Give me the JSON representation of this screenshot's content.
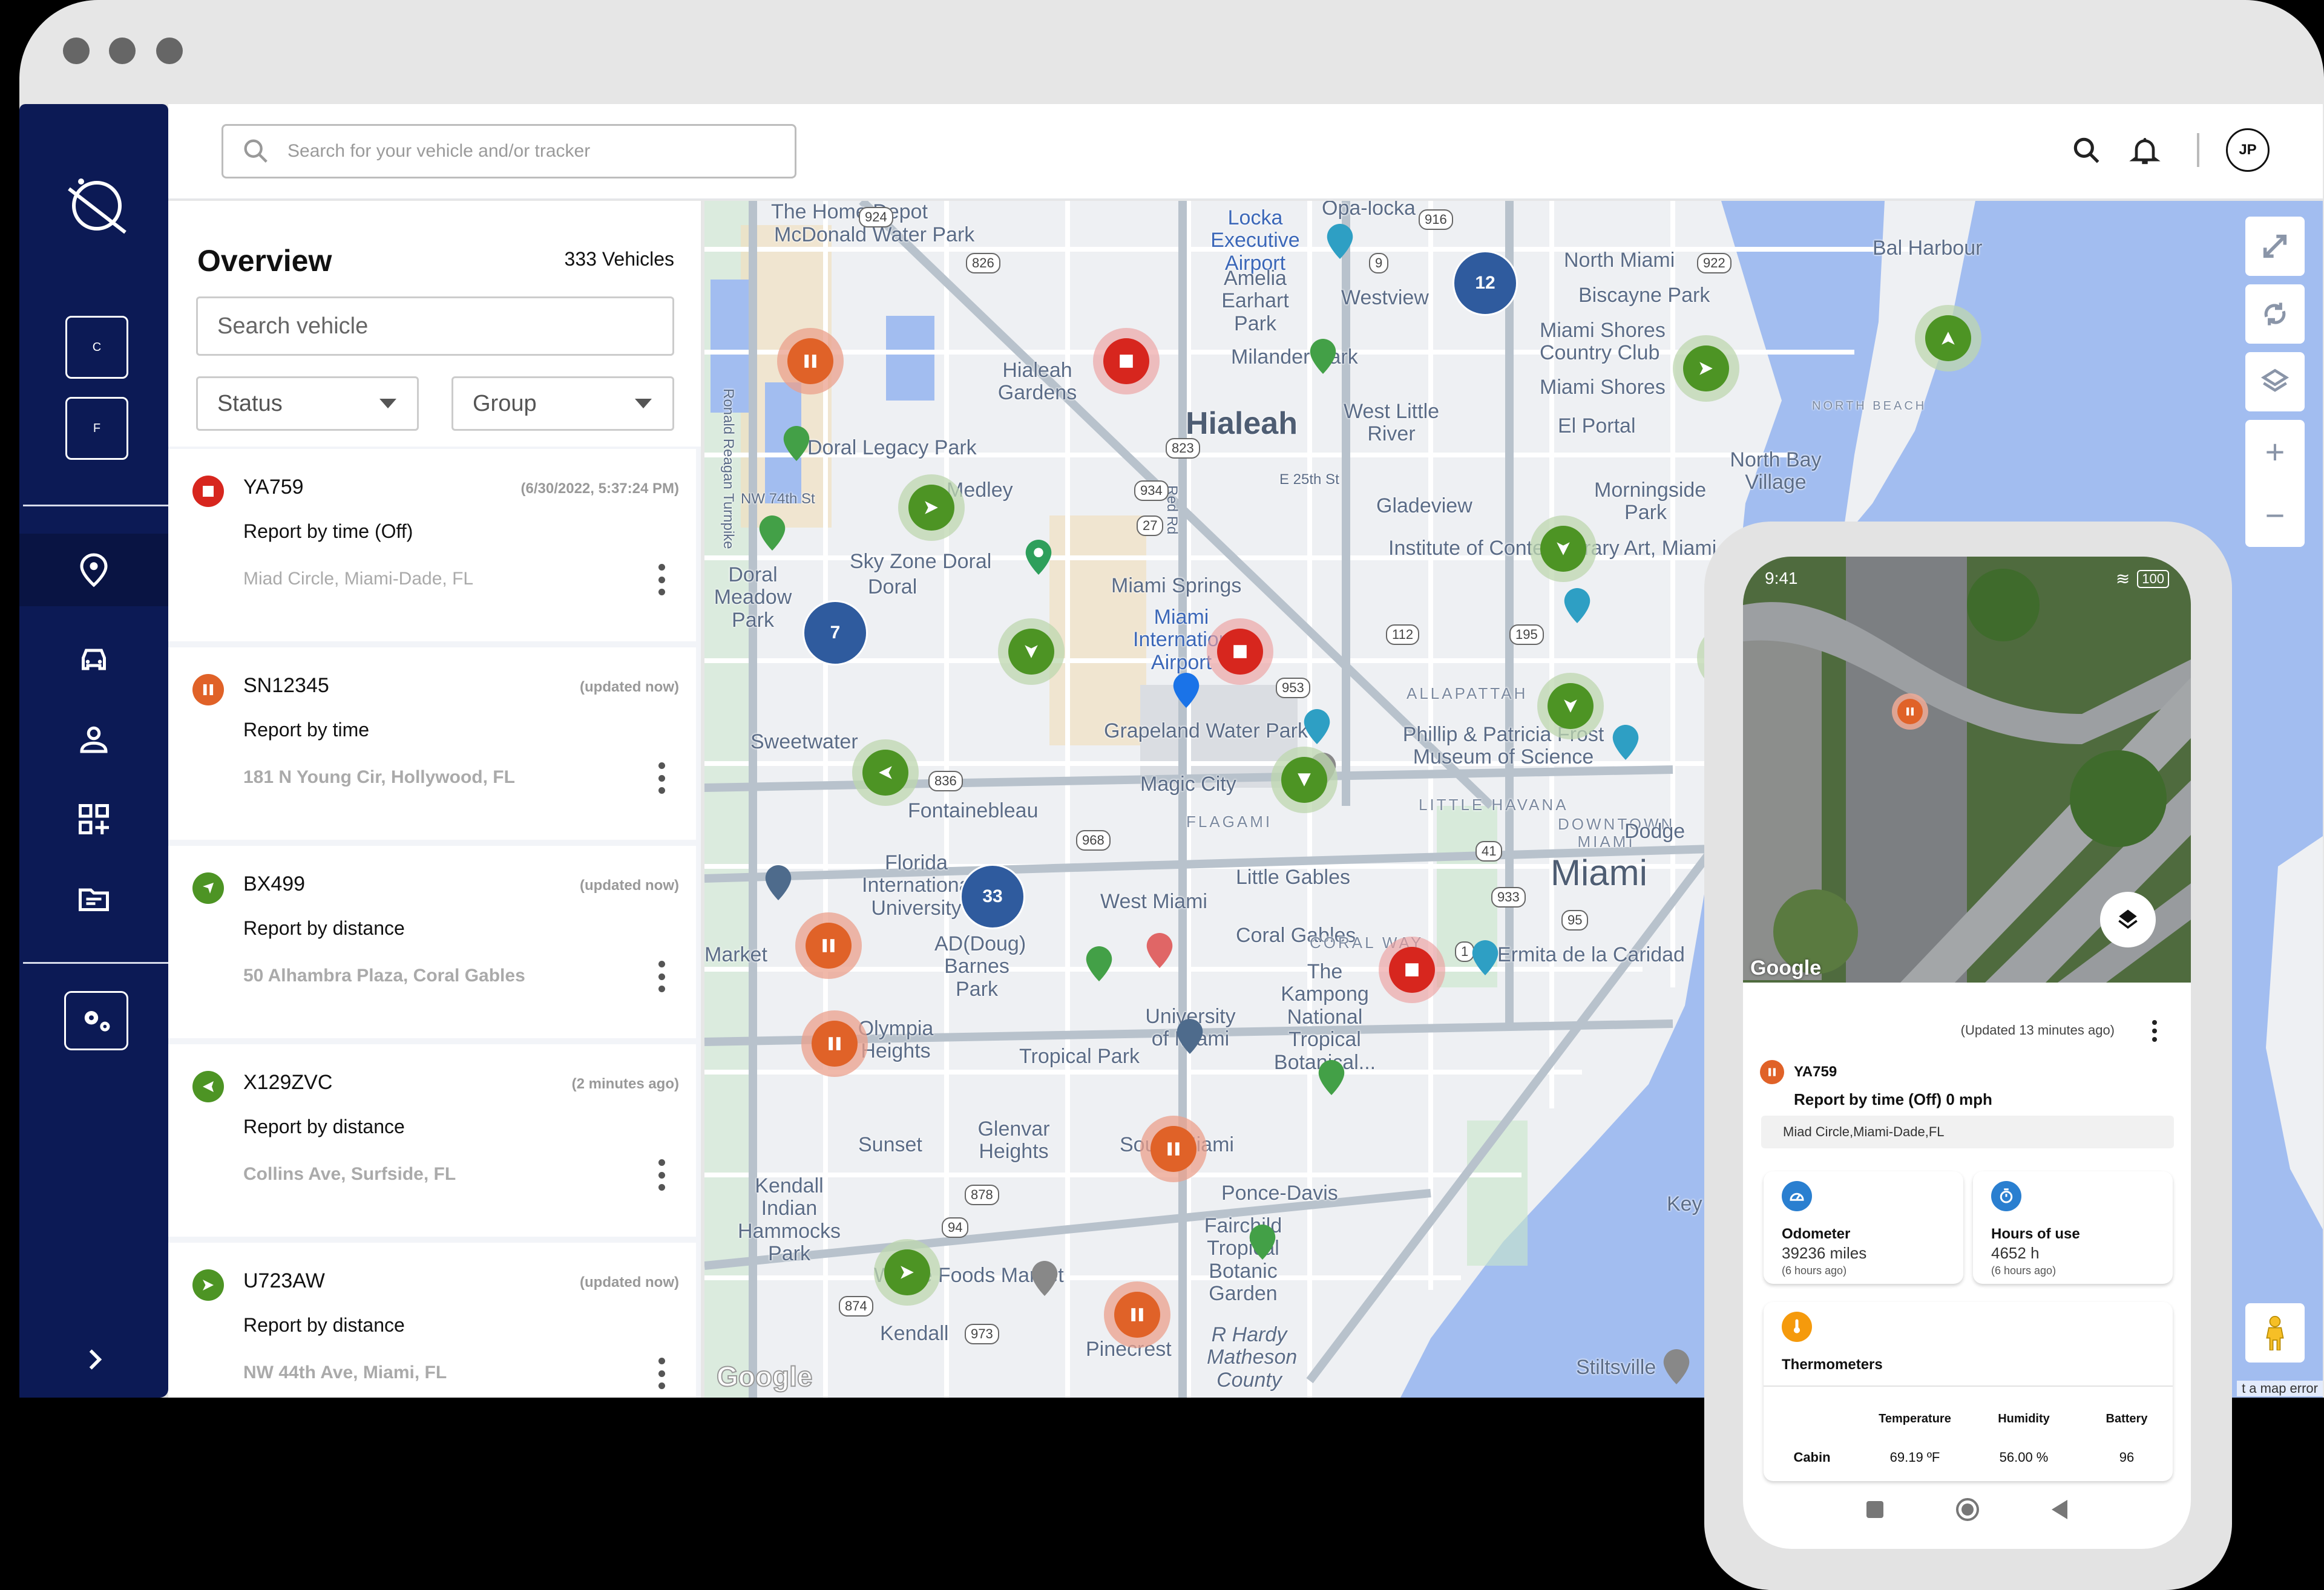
{
  "browser": {
    "window_dots": 3
  },
  "sidebar": {
    "logo": "planet-logo-icon",
    "shortcut_buttons": [
      {
        "label": "C"
      },
      {
        "label": "F"
      }
    ],
    "nav_items": [
      {
        "icon": "location-pin-icon",
        "active": true
      },
      {
        "icon": "car-icon",
        "active": false
      },
      {
        "icon": "user-icon",
        "active": false
      },
      {
        "icon": "add-widget-icon",
        "active": false
      },
      {
        "icon": "folder-icon",
        "active": false
      }
    ],
    "settings_icon": "gears-icon",
    "expand_icon": "chevron-right-icon"
  },
  "header": {
    "search_placeholder": "Search for your vehicle and/or tracker",
    "icons": [
      "search-icon",
      "bell-icon"
    ],
    "avatar_initials": "JP"
  },
  "overview": {
    "title": "Overview",
    "vehicle_count": "333 Vehicles",
    "search_placeholder": "Search vehicle",
    "filters": {
      "status": "Status",
      "group": "Group"
    },
    "vehicles": [
      {
        "id": "YA759",
        "status": "stopped",
        "time": "(6/30/2022, 5:37:24 PM)",
        "report": "Report by time (Off)",
        "address": "Miad Circle, Miami-Dade, FL"
      },
      {
        "id": "SN12345",
        "status": "paused",
        "time": "(updated now)",
        "report": "Report by time",
        "address": "181 N Young Cir, Hollywood, FL"
      },
      {
        "id": "BX499",
        "status": "moving",
        "time": "(updated now)",
        "report": "Report by distance",
        "address": "50 Alhambra Plaza, Coral Gables"
      },
      {
        "id": "X129ZVC",
        "status": "moving",
        "time": "(2 minutes ago)",
        "report": "Report by distance",
        "address": "Collins Ave, Surfside, FL"
      },
      {
        "id": "U723AW",
        "status": "moving",
        "time": "(updated now)",
        "report": "Report by distance",
        "address": "NW 44th Ave, Miami, FL"
      }
    ]
  },
  "map": {
    "labels": {
      "home_depot": "The Home Depot",
      "mcdonald": "McDonald Water Park",
      "opa_locka": "Opa-locka",
      "locka_exec": "Locka Executive Airport",
      "amelia": "Amelia Earhart Park",
      "north_miami": "North Miami",
      "bal_harbour": "Bal Harbour",
      "westview": "Westview",
      "biscayne_park": "Biscayne Park",
      "hialeah_gardens": "Hialeah Gardens",
      "milander": "Milander Park",
      "miami_shores_cc": "Miami Shores Country Club",
      "hialeah": "Hialeah",
      "west_little_river": "West Little River",
      "miami_shores": "Miami Shores",
      "el_portal": "El Portal",
      "doral_legacy": "Doral Legacy Park",
      "north_bay": "North Bay Village",
      "medley": "Medley",
      "nw74": "NW 74th St",
      "e25": "E 25th St",
      "gladeview": "Gladeview",
      "morningside": "Morningside Park",
      "sky_zone": "Sky Zone Doral",
      "doral_meadow": "Doral Meadow Park",
      "doral": "Doral",
      "miami_springs": "Miami Springs",
      "institute": "Institute of Contemporary Art, Miami",
      "miami_intl": "Miami International Airport",
      "sweetwater": "Sweetwater",
      "grapeland": "Grapeland Water Park",
      "allapattah": "ALLAPATTAH",
      "frost": "Phillip & Patricia Frost Museum of Science",
      "magic_city": "Magic City",
      "little_havana": "LITTLE HAVANA",
      "fontainebleau": "Fontainebleau",
      "flagami": "FLAGAMI",
      "downtown": "DOWNTOWN MIAMI",
      "dodge": "Dodge",
      "fiu": "Florida International University",
      "west_miami": "West Miami",
      "little_gables": "Little Gables",
      "miami": "Miami",
      "coral_gables": "Coral Gables",
      "ad_barnes": "AD(Doug) Barnes Park",
      "kampong": "The Kampong National Tropical Botanical...",
      "ermita": "Ermita de la Caridad",
      "olympia": "Olympia Heights",
      "tropical_park": "Tropical Park",
      "univ_miami": "University of Miami",
      "market": "Market",
      "sunset": "Sunset",
      "glenvar": "Glenvar Heights",
      "south_miami": "South Miami",
      "ponce_davis": "Ponce-Davis",
      "kendall_indian": "Kendall Indian Hammocks Park",
      "fairchild": "Fairchild Tropical Botanic Garden",
      "key": "Key",
      "whole_foods": "Whole Foods Market",
      "kendall": "Kendall",
      "pinecrest": "Pinecrest",
      "matheson": "R Hardy Matheson County",
      "stiltsville": "Stiltsville",
      "reagan": "Ronald Reagan Turnpike",
      "red_rd": "Red Rd",
      "coral_way": "CORAL WAY",
      "north_beach": "NORTH BEACH"
    },
    "route_shields": [
      "924",
      "826",
      "916",
      "9",
      "922",
      "823",
      "934",
      "27",
      "112",
      "195",
      "953",
      "836",
      "968",
      "41",
      "933",
      "95",
      "1",
      "878",
      "94",
      "874",
      "973"
    ],
    "clusters": [
      "12",
      "7",
      "33"
    ],
    "controls": [
      "fullscreen-icon",
      "refresh-icon",
      "layers-icon",
      "zoom-in-icon",
      "zoom-out-icon"
    ],
    "zoom_in": "+",
    "zoom_out": "−",
    "attribution": "Google",
    "report_error": "t a map error"
  },
  "phone": {
    "time": "9:41",
    "battery": "100",
    "attribution": "Google",
    "updated": "(Updated 13 minutes ago)",
    "vehicle_id": "YA759",
    "report": "Report by time (Off) 0 mph",
    "address": "Miad Circle,Miami-Dade,FL",
    "odometer": {
      "title": "Odometer",
      "value": "39236 miles",
      "updated": "(6 hours ago)"
    },
    "hours": {
      "title": "Hours of use",
      "value": "4652 h",
      "updated": "(6 hours ago)"
    },
    "thermometers": {
      "title": "Thermometers",
      "columns": [
        "Temperature",
        "Humidity",
        "Battery"
      ],
      "rows": [
        {
          "name": "Cabin",
          "temperature": "69.19 ºF",
          "humidity": "56.00 %",
          "battery": "96"
        }
      ]
    }
  },
  "colors": {
    "sidebar_bg": "#0c1a55",
    "stopped": "#d7261e",
    "paused": "#e06228",
    "moving": "#4d9424",
    "cluster": "#2f5b9e",
    "water": "#a2bdf0",
    "info_blue": "#2a7fd0",
    "thermo_orange": "#f59a0c"
  }
}
